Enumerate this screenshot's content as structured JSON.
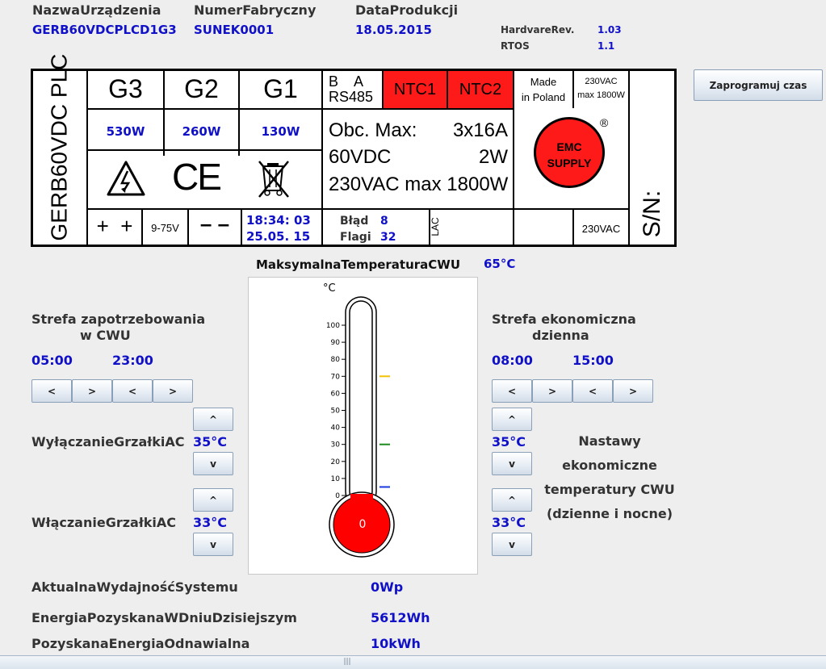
{
  "header": {
    "device_name_label": "NazwaUrządzenia",
    "device_name_value": "GERB60VDCPLCD1G3",
    "serial_label": "NumerFabryczny",
    "serial_value": "SUNEK0001",
    "date_label": "DataProdukcji",
    "date_value": "18.05.2015",
    "hw_label": "HardvareRev.",
    "hw_value": "1.03",
    "rtos_label": "RTOS",
    "rtos_value": "1.1"
  },
  "program_button": "Zaprogramuj czas",
  "plate": {
    "vertical_title": "GERB60VDC PLC",
    "g3": "G3",
    "g2": "G2",
    "g1": "G1",
    "g3_power": "530W",
    "g2_power": "260W",
    "g1_power": "130W",
    "ba": "B    A",
    "rs485": "RS485",
    "ntc1": "NTC1",
    "ntc2": "NTC2",
    "made1": "Made",
    "made2": "in Poland",
    "vac1": "230VAC",
    "vac2": "max 1800W",
    "obc_label": "Obc. Max:",
    "obc_value": "3x16A",
    "vdc": "60VDC",
    "vdc_w": "2W",
    "vac_line": "230VAC max 1800W",
    "emc1": "EMC",
    "emc2": "SUPPLY",
    "reg": "®",
    "ce": "CE",
    "plus": "+  +",
    "range": "9-75V",
    "minus": "– –",
    "time": "18:34: 03",
    "date": "25.05. 15",
    "error_label": "Błąd",
    "error_value": "8",
    "flags_label": "Flagi",
    "flags_value": "32",
    "lac": "LAC",
    "vac_bottom": "230VAC",
    "sn": "S/N:"
  },
  "max_temp_label": "MaksymalnaTemperaturaCWU",
  "max_temp_value": "65°C",
  "thermometer": {
    "unit": "°C",
    "ticks": [
      "100",
      "90",
      "80",
      "70",
      "60",
      "50",
      "40",
      "30",
      "20",
      "10",
      "0"
    ],
    "value": "0",
    "marker_yellow": 70,
    "marker_green": 30,
    "marker_blue": 5
  },
  "left_zone": {
    "title1": "Strefa zapotrzebowania",
    "title2": "w CWU",
    "start": "05:00",
    "end": "23:00",
    "buttons": [
      "<",
      ">",
      "<",
      ">"
    ]
  },
  "right_zone": {
    "title1": "Strefa ekonomiczna",
    "title2": "dzienna",
    "start": "08:00",
    "end": "15:00",
    "buttons": [
      "<",
      ">",
      "<",
      ">"
    ]
  },
  "heater_off_label": "WyłączanieGrzałkiAC",
  "heater_off_value": "35°C",
  "heater_on_label": "WłączanieGrzałkiAC",
  "heater_on_value": "33°C",
  "eco_off_value": "35°C",
  "eco_on_value": "33°C",
  "up": "^",
  "down": "v",
  "eco_note": [
    "Nastawy",
    "ekonomiczne",
    "temperatury CWU",
    "(dzienne i nocne)"
  ],
  "stats": {
    "perf_label": "AktualnaWydajnośćSystemu",
    "perf_value": "0Wp",
    "energy_label": "EnergiaPozyskanaWDniuDzisiejszym",
    "energy_value": "5612Wh",
    "renew_label": "PozyskanaEnergiaOdnawialna",
    "renew_value": "10kWh"
  },
  "scroll_grip": "|||"
}
